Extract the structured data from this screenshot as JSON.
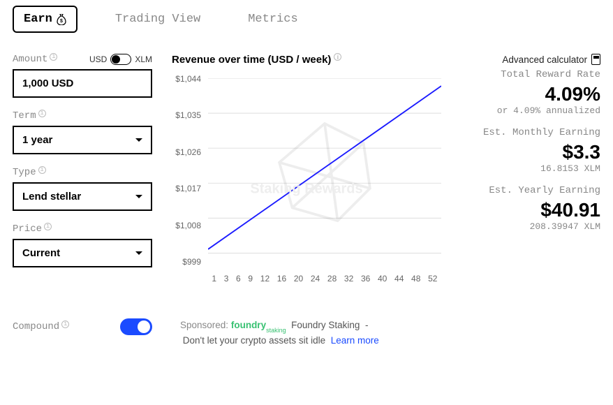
{
  "tabs": {
    "earn": "Earn",
    "trading_view": "Trading View",
    "metrics": "Metrics"
  },
  "form": {
    "amount_label": "Amount",
    "currency_left": "USD",
    "currency_right": "XLM",
    "amount_value": "1,000 USD",
    "term_label": "Term",
    "term_value": "1 year",
    "type_label": "Type",
    "type_value": "Lend stellar",
    "price_label": "Price",
    "price_value": "Current",
    "compound_label": "Compound"
  },
  "chart_data": {
    "type": "line",
    "title": "Revenue over time (USD / week)",
    "xlabel": "",
    "ylabel": "",
    "watermark": "Staking Rewards",
    "y_ticks": [
      "$1,044",
      "$1,035",
      "$1,026",
      "$1,017",
      "$1,008",
      "$999"
    ],
    "x_ticks": [
      "1",
      "3",
      "6",
      "9",
      "12",
      "16",
      "20",
      "24",
      "28",
      "32",
      "36",
      "40",
      "44",
      "48",
      "52"
    ],
    "series": [
      {
        "name": "Revenue",
        "x": [
          1,
          52
        ],
        "y": [
          1000,
          1042
        ]
      }
    ],
    "ylim": [
      999,
      1044
    ]
  },
  "metrics": {
    "adv": "Advanced calculator",
    "total_rate_label": "Total Reward Rate",
    "total_rate": "4.09%",
    "total_rate_sub": "or 4.09% annualized",
    "monthly_label": "Est. Monthly Earning",
    "monthly": "$3.3",
    "monthly_sub": "16.8153 XLM",
    "yearly_label": "Est. Yearly Earning",
    "yearly": "$40.91",
    "yearly_sub": "208.39947 XLM"
  },
  "sponsor": {
    "label": "Sponsored:",
    "logo": "foundry",
    "logo_sub": "staking",
    "name": "Foundry Staking",
    "tagline": "Don't let your crypto assets sit idle",
    "learn": "Learn more"
  }
}
